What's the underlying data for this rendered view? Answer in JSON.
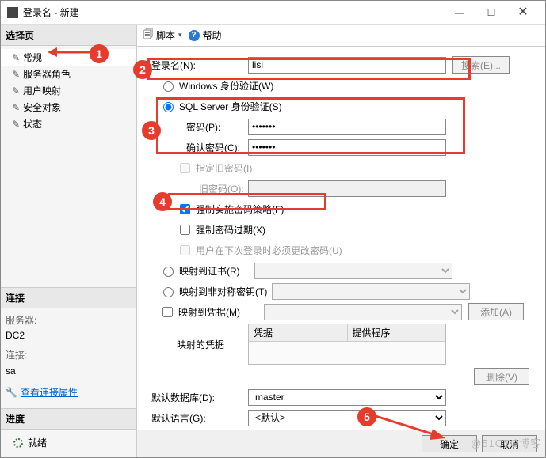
{
  "window": {
    "title": "登录名 - 新建"
  },
  "sidebar": {
    "select_header": "选择页",
    "items": [
      {
        "label": "常规"
      },
      {
        "label": "服务器角色"
      },
      {
        "label": "用户映射"
      },
      {
        "label": "安全对象"
      },
      {
        "label": "状态"
      }
    ],
    "connection_header": "连接",
    "server_label": "服务器:",
    "server_value": "DC2",
    "conn_label": "连接:",
    "conn_value": "sa",
    "view_conn_props": "查看连接属性",
    "progress_header": "进度",
    "status_text": "就绪"
  },
  "toolbar": {
    "script": "脚本",
    "help": "帮助"
  },
  "form": {
    "login_name_label": "登录名(N):",
    "login_name_value": "lisi",
    "search_btn": "搜索(E)...",
    "auth_windows": "Windows 身份验证(W)",
    "auth_sql": "SQL Server 身份验证(S)",
    "password_label": "密码(P):",
    "password_value": "•••••••",
    "confirm_label": "确认密码(C):",
    "confirm_value": "•••••••",
    "specify_old_pw": "指定旧密码(I)",
    "old_pw_label": "旧密码(O):",
    "enforce_policy": "强制实施密码策略(F)",
    "enforce_expire": "强制密码过期(X)",
    "must_change": "用户在下次登录时必须更改密码(U)",
    "map_cert": "映射到证书(R)",
    "map_asym": "映射到非对称密钥(T)",
    "map_cred": "映射到凭据(M)",
    "add_btn": "添加(A)",
    "mapped_creds_label": "映射的凭据",
    "grid_col_cred": "凭据",
    "grid_col_provider": "提供程序",
    "remove_btn": "删除(V)",
    "default_db_label": "默认数据库(D):",
    "default_db_value": "master",
    "default_lang_label": "默认语言(G):",
    "default_lang_value": "<默认>"
  },
  "footer": {
    "ok": "确定",
    "cancel": "取消"
  },
  "callouts": {
    "c1": "1",
    "c2": "2",
    "c3": "3",
    "c4": "4",
    "c5": "5"
  },
  "watermark": "@51CTO博客"
}
